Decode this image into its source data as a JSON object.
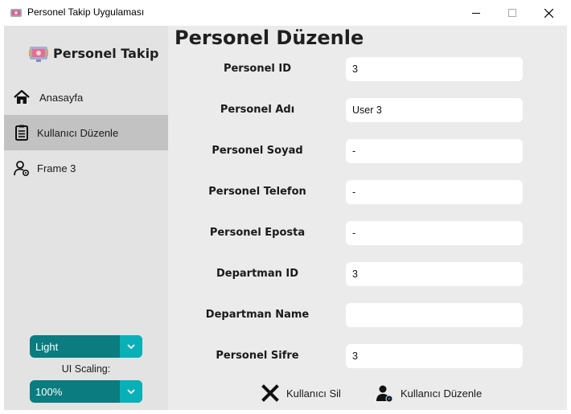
{
  "window": {
    "title": "Personel Takip Uygulaması"
  },
  "sidebar": {
    "brand": "Personel Takip",
    "items": [
      {
        "label": "Anasayfa",
        "icon": "home-icon"
      },
      {
        "label": "Kullanıcı Düzenle",
        "icon": "clipboard-icon",
        "active": true
      },
      {
        "label": "Frame 3",
        "icon": "user-settings-icon"
      }
    ],
    "theme_select": {
      "value": "Light"
    },
    "scaling_label": "UI Scaling:",
    "scaling_select": {
      "value": "100%"
    }
  },
  "main": {
    "title": "Personel Düzenle",
    "fields": [
      {
        "label": "Personel ID",
        "value": "3"
      },
      {
        "label": "Personel Adı",
        "value": "User 3"
      },
      {
        "label": "Personel Soyad",
        "value": "-"
      },
      {
        "label": "Personel Telefon",
        "value": "-"
      },
      {
        "label": "Personel Eposta",
        "value": "-"
      },
      {
        "label": "Departman ID",
        "value": "3"
      },
      {
        "label": "Departman Name",
        "value": ""
      },
      {
        "label": "Personel Sifre",
        "value": "3"
      }
    ],
    "delete_label": "Kullanıcı Sil",
    "edit_label": "Kullanıcı Düzenle"
  },
  "colors": {
    "select_bg": "#0b7c7f",
    "select_arrow_bg": "#0ab0b8",
    "active_nav_bg": "#c2c2c2",
    "sidebar_bg": "#e3e3e3",
    "main_bg": "#ebebeb"
  }
}
